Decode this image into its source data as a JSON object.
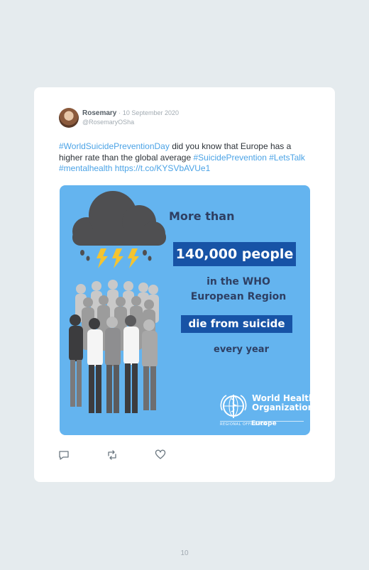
{
  "tweet": {
    "author_name": "Rosemary",
    "separator": "·",
    "date": "10 September 2020",
    "handle": "@RosemaryOSha",
    "text": {
      "tag1": "#WorldSuicidePreventionDay",
      "body": " did you know that Europe has a higher rate than the global average ",
      "tag2": "#SuicidePrevention",
      "tag3": "#LetsTalk",
      "tag4": "#mentalhealth",
      "link": "https://t.co/KYSVbAVUe1"
    }
  },
  "media": {
    "line1": "More than",
    "highlight1": "140,000 people",
    "line2": "in the WHO European Region",
    "highlight2": "die from suicide",
    "line3": "every year",
    "logo": {
      "name_line1": "World Health",
      "name_line2": "Organization",
      "sub": "REGIONAL OFFICE FOR",
      "region": "Europe"
    },
    "background_color": "#64b4ef",
    "highlight_color": "#1753a6"
  },
  "actions": {
    "reply_icon": "reply-icon",
    "retweet_icon": "retweet-icon",
    "like_icon": "heart-icon"
  },
  "page_number": "10"
}
